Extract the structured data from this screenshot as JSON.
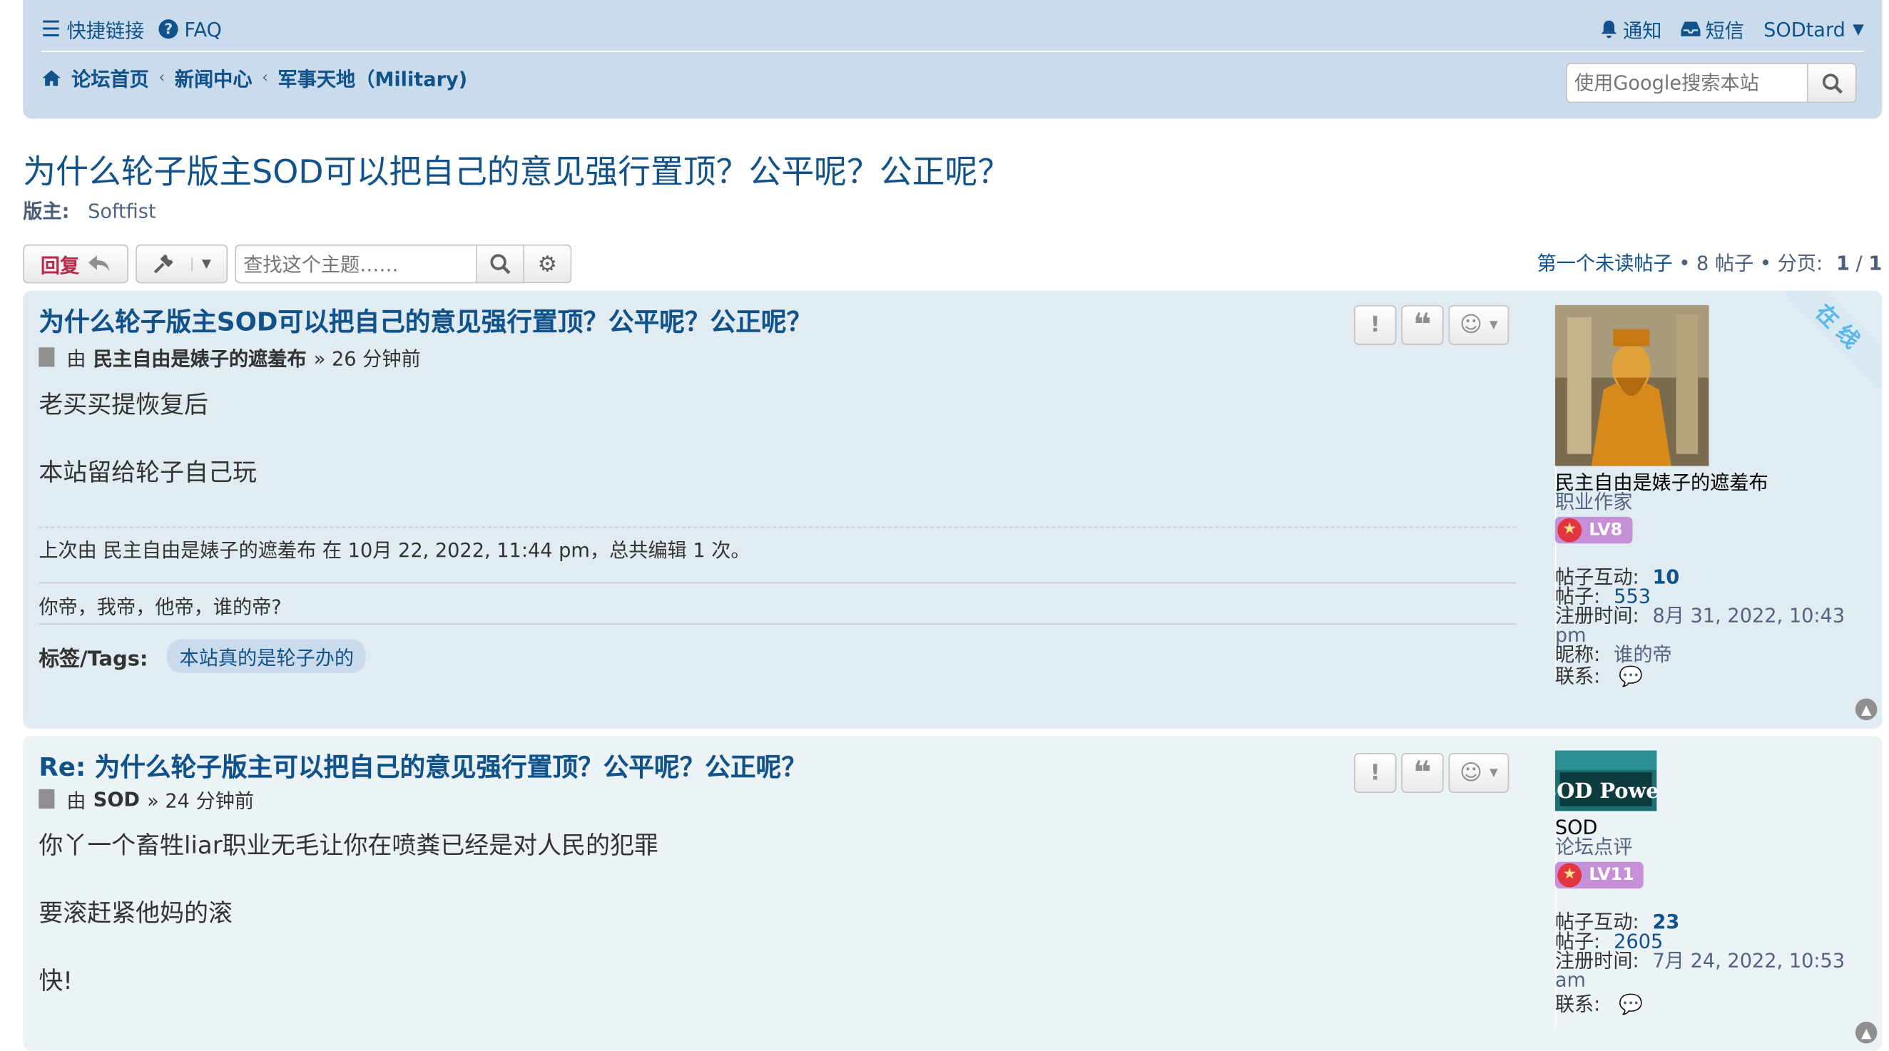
{
  "topnav": {
    "quicklinks": "快捷链接",
    "faq": "FAQ",
    "notifications": "通知",
    "messages": "短信",
    "username": "SODtard"
  },
  "breadcrumbs": [
    "论坛首页",
    "新闻中心",
    "军事天地（Military)"
  ],
  "search": {
    "placeholder": "使用Google搜索本站"
  },
  "topic": {
    "title": "为什么轮子版主SOD可以把自己的意见强行置顶？公平呢？公正呢？",
    "moderator_label": "版主:",
    "moderator": "Softfist"
  },
  "actions": {
    "reply_label": "回复",
    "topic_search_placeholder": "查找这个主题……"
  },
  "pagination": {
    "first_unread": "第一个未读帖子",
    "post_count": "8 帖子",
    "page_label": "分页:",
    "page_current": "1",
    "page_total": "1"
  },
  "posts": [
    {
      "title": "为什么轮子版主SOD可以把自己的意见强行置顶？公平呢？公正呢？",
      "by": "由",
      "author": "民主自由是婊子的遮羞布",
      "time": "» 26 分钟前",
      "content": [
        "老买买提恢复后",
        "本站留给轮子自己玩"
      ],
      "edit_note": "上次由 民主自由是婊子的遮羞布 在 10月 22, 2022, 11:44 pm，总共编辑 1 次。",
      "signature": "你帝，我帝，他帝，谁的帝?",
      "tags_label": "标签/Tags:",
      "tag": "本站真的是轮子办的",
      "online": "在线",
      "profile": {
        "name": "民主自由是婊子的遮羞布",
        "rank": "职业作家",
        "level": "LV8",
        "interactions_label": "帖子互动:",
        "interactions": "10",
        "posts_label": "帖子:",
        "posts": "553",
        "joined_label": "注册时间:",
        "joined": "8月 31, 2022, 10:43 pm",
        "nickname_label": "昵称:",
        "nickname": "谁的帝",
        "contact_label": "联系:"
      }
    },
    {
      "title": "Re: 为什么轮子版主可以把自己的意见强行置顶？公平呢？公正呢？",
      "by": "由",
      "author": "SOD",
      "time": "» 24 分钟前",
      "content": [
        "你丫一个畜牲liar职业无毛让你在喷粪已经是对人民的犯罪",
        "要滚赶紧他妈的滚",
        "快!"
      ],
      "profile": {
        "name": "SOD",
        "rank": "论坛点评",
        "level": "LV11",
        "avatar_text": "SOD Power",
        "interactions_label": "帖子互动:",
        "interactions": "23",
        "posts_label": "帖子:",
        "posts": "2605",
        "joined_label": "注册时间:",
        "joined": "7月 24, 2022, 10:53 am",
        "contact_label": "联系:"
      }
    }
  ]
}
